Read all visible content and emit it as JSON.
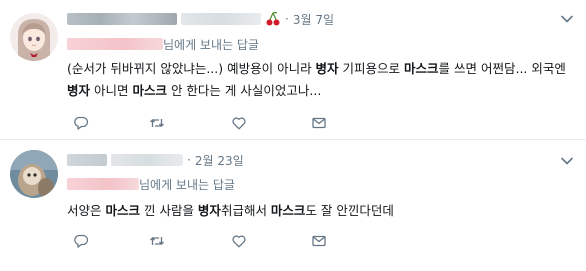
{
  "tweets": [
    {
      "date": "3월 7일",
      "reply_suffix": "님에게 보내는 답글",
      "text_segments": [
        {
          "t": "(순서가 뒤바뀌지 않았냐는...) 예방용이 아니라 ",
          "b": false
        },
        {
          "t": "병자",
          "b": true
        },
        {
          "t": " 기피용으로 ",
          "b": false
        },
        {
          "t": "마스크",
          "b": true
        },
        {
          "t": "를 쓰면 어쩐담... 외국엔 ",
          "b": false
        },
        {
          "t": "병자",
          "b": true
        },
        {
          "t": " 아니면 ",
          "b": false
        },
        {
          "t": "마스크",
          "b": true
        },
        {
          "t": " 안 한다는 게 사실이었고나...",
          "b": false
        }
      ]
    },
    {
      "date": "2월 23일",
      "reply_suffix": "님에게 보내는 답글",
      "text_segments": [
        {
          "t": "서양은 ",
          "b": false
        },
        {
          "t": "마스크",
          "b": true
        },
        {
          "t": " 낀 사람을 ",
          "b": false
        },
        {
          "t": "병자",
          "b": true
        },
        {
          "t": "취급해서 ",
          "b": false
        },
        {
          "t": "마스크",
          "b": true
        },
        {
          "t": "도 잘 안낀다던데",
          "b": false
        }
      ]
    }
  ],
  "dot_separator": "·",
  "icons": [
    "reply-icon",
    "retweet-icon",
    "like-icon",
    "message-icon",
    "chevron-down-icon",
    "cherry-icon"
  ],
  "colors": {
    "text": "#14171a",
    "secondary": "#657786",
    "border": "#e6ecf0"
  }
}
